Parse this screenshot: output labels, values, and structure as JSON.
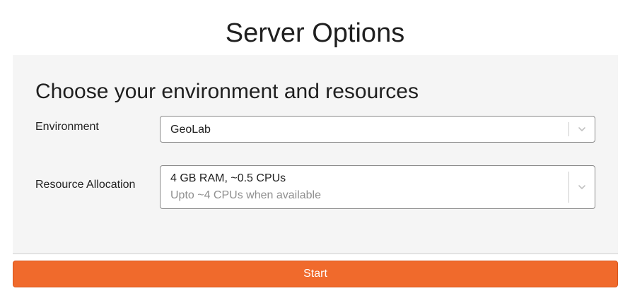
{
  "page": {
    "title": "Server Options"
  },
  "form": {
    "heading": "Choose your environment and resources",
    "environment": {
      "label": "Environment",
      "selected": "GeoLab",
      "icon": "chevron-down-icon"
    },
    "resources": {
      "label": "Resource Allocation",
      "selected": "4 GB RAM, ~0.5 CPUs",
      "selected_description": "Upto ~4 CPUs when available",
      "icon": "chevron-down-icon"
    }
  },
  "actions": {
    "start_label": "Start"
  },
  "colors": {
    "accent": "#f06a2c",
    "panel_background": "#f5f5f5",
    "muted_text": "#8f8f8f"
  }
}
